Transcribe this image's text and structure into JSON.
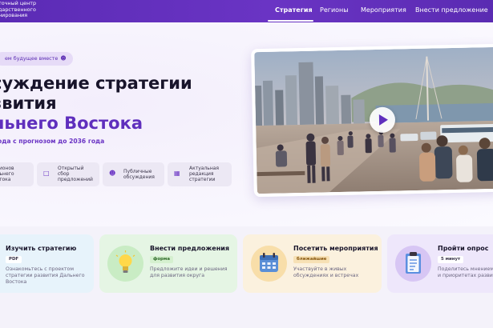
{
  "header": {
    "brand_lines": "точный центр\nдарственного\nнирования",
    "nav": [
      {
        "label": "Стратегия",
        "active": true
      },
      {
        "label": "Регионы",
        "active": false
      },
      {
        "label": "Мероприятия",
        "active": false
      },
      {
        "label": "Внести предложение",
        "active": false
      }
    ]
  },
  "hero": {
    "pill_label": "ем будущее вместе",
    "pill_icon": "people-icon",
    "headline_line1": "суждение стратегии",
    "headline_line2": "звития",
    "headline_line3": "льнего Востока",
    "subhead": "ода с прогнозом до 2036 года",
    "chips": [
      {
        "icon": "map-icon",
        "text": "егионов\nальнего\nостока"
      },
      {
        "icon": "chat-icon",
        "text": "Открытый\nсбор\nпредложений"
      },
      {
        "icon": "people-icon",
        "text": "Публичные\nобсуждения"
      },
      {
        "icon": "calendar-icon",
        "text": "Актуальная\nредакция\nстратегии"
      }
    ],
    "video": {
      "icon": "play-icon"
    }
  },
  "cards": [
    {
      "title": "Изучить стратегию",
      "badge": "PDF",
      "desc": "Ознакомьтесь с проектом\nстратегии развития Дальнего\nВостока",
      "icon": "document-icon",
      "bg": "#e7f3fb",
      "badge_bg": "#ffffff",
      "badge_color": "#3a354a"
    },
    {
      "title": "Внести предложения",
      "badge": "форма",
      "desc": "Предложите идеи и решения\nдля развития округа",
      "icon": "lightbulb-icon",
      "bg": "#e5f5e4",
      "badge_bg": "#d5f0cf",
      "badge_color": "#2f6b2a"
    },
    {
      "title": "Посетить мероприятия",
      "badge": "ближайшие",
      "desc": "Участвуйте в живых\nобсуждениях и встречах",
      "icon": "calendar-icon",
      "bg": "#fbf1de",
      "badge_bg": "#f7e1b5",
      "badge_color": "#8a5a12"
    },
    {
      "title": "Пройти опрос",
      "badge": "5 минут",
      "desc": "Поделитесь мнением о\nи приоритетах развит",
      "icon": "clipboard-icon",
      "bg": "#eee7fb",
      "badge_bg": "#ffffff",
      "badge_color": "#3a354a"
    }
  ]
}
